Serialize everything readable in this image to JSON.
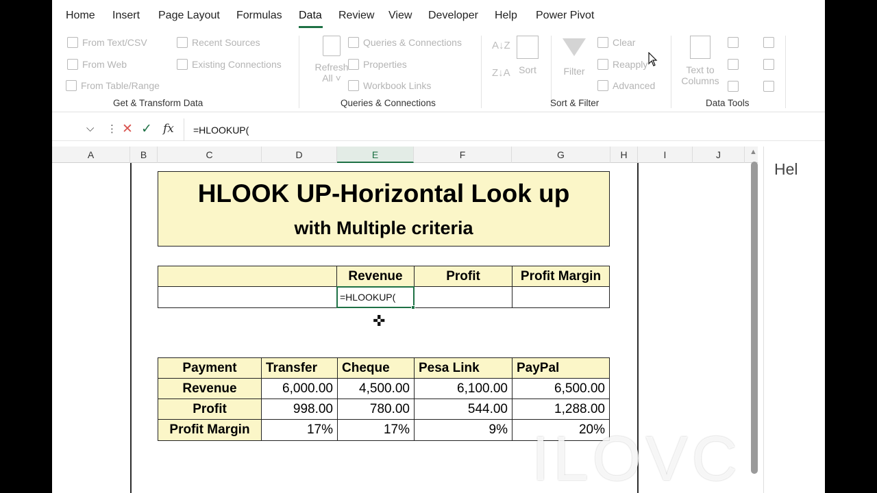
{
  "menu": {
    "tabs": [
      "Home",
      "Insert",
      "Page Layout",
      "Formulas",
      "Data",
      "Review",
      "View",
      "Developer",
      "Help",
      "Power Pivot"
    ],
    "active": "Data"
  },
  "ribbon": {
    "get_transform": {
      "from_text_csv": "From Text/CSV",
      "from_web": "From Web",
      "from_table": "From Table/Range",
      "recent_sources": "Recent Sources",
      "existing_connections": "Existing Connections",
      "label": "Get & Transform Data"
    },
    "queries": {
      "refresh": "Refresh",
      "refresh_all": "All ˅",
      "queries_connections": "Queries & Connections",
      "properties": "Properties",
      "workbook_links": "Workbook Links",
      "label": "Queries & Connections"
    },
    "sort_filter": {
      "sort": "Sort",
      "filter": "Filter",
      "clear": "Clear",
      "reapply": "Reapply",
      "advanced": "Advanced",
      "label": "Sort & Filter"
    },
    "data_tools": {
      "text_to": "Text to",
      "columns": "Columns",
      "label": "Data Tools"
    }
  },
  "formula_bar": {
    "fx": "fx",
    "formula": "=HLOOKUP("
  },
  "columns": [
    "A",
    "B",
    "C",
    "D",
    "E",
    "F",
    "G",
    "H",
    "I",
    "J"
  ],
  "sheet": {
    "title": "HLOOK UP-Horizontal Look up",
    "subtitle": "with Multiple criteria",
    "lookup_headers": [
      "Revenue",
      "Profit",
      "Profit Margin"
    ],
    "active_cell_text": "=HLOOKUP(",
    "table_header": [
      "Payment",
      "Transfer",
      "Cheque",
      "Pesa Link",
      "PayPal"
    ],
    "table_rows": [
      {
        "label": "Revenue",
        "values": [
          "6,000.00",
          "4,500.00",
          "6,100.00",
          "6,500.00"
        ]
      },
      {
        "label": "Profit",
        "values": [
          "998.00",
          "780.00",
          "544.00",
          "1,288.00"
        ]
      },
      {
        "label": "Profit Margin",
        "values": [
          "17%",
          "17%",
          "9%",
          "20%"
        ]
      }
    ]
  },
  "right_pane": {
    "text": "Hel"
  },
  "watermark": "ILOVC",
  "colors": {
    "accent": "#1e7145",
    "header_fill": "#fbf6c8"
  }
}
